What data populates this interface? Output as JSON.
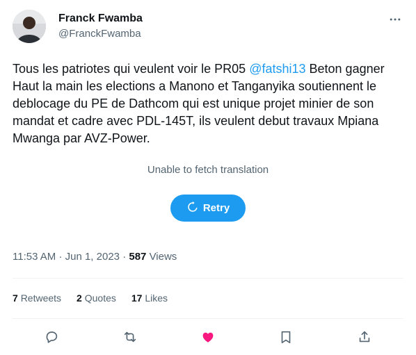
{
  "author": {
    "display_name": "Franck Fwamba",
    "handle": "@FranckFwamba"
  },
  "tweet": {
    "text_before": "Tous les patriotes qui veulent voir le PR05 ",
    "mention": "@fatshi13",
    "text_after": " Beton gagner Haut la main les elections a Manono et Tanganyika soutiennent le deblocage du PE de Dathcom qui est unique projet minier de son mandat et cadre avec PDL-145T, ils veulent debut travaux Mpiana Mwanga par AVZ-Power."
  },
  "translation": {
    "status": "Unable to fetch translation",
    "retry_label": "Retry"
  },
  "meta": {
    "time": "11:53 AM",
    "separator": "·",
    "date": "Jun 1, 2023",
    "views_count": "587",
    "views_label": "Views"
  },
  "stats": {
    "retweets_count": "7",
    "retweets_label": "Retweets",
    "quotes_count": "2",
    "quotes_label": "Quotes",
    "likes_count": "17",
    "likes_label": "Likes"
  },
  "colors": {
    "accent": "#1d9bf0",
    "like": "#f91880",
    "secondary_text": "#536471"
  },
  "icons": [
    "more-icon",
    "refresh-icon",
    "reply-icon",
    "retweet-icon",
    "like-icon",
    "bookmark-icon",
    "share-icon"
  ]
}
